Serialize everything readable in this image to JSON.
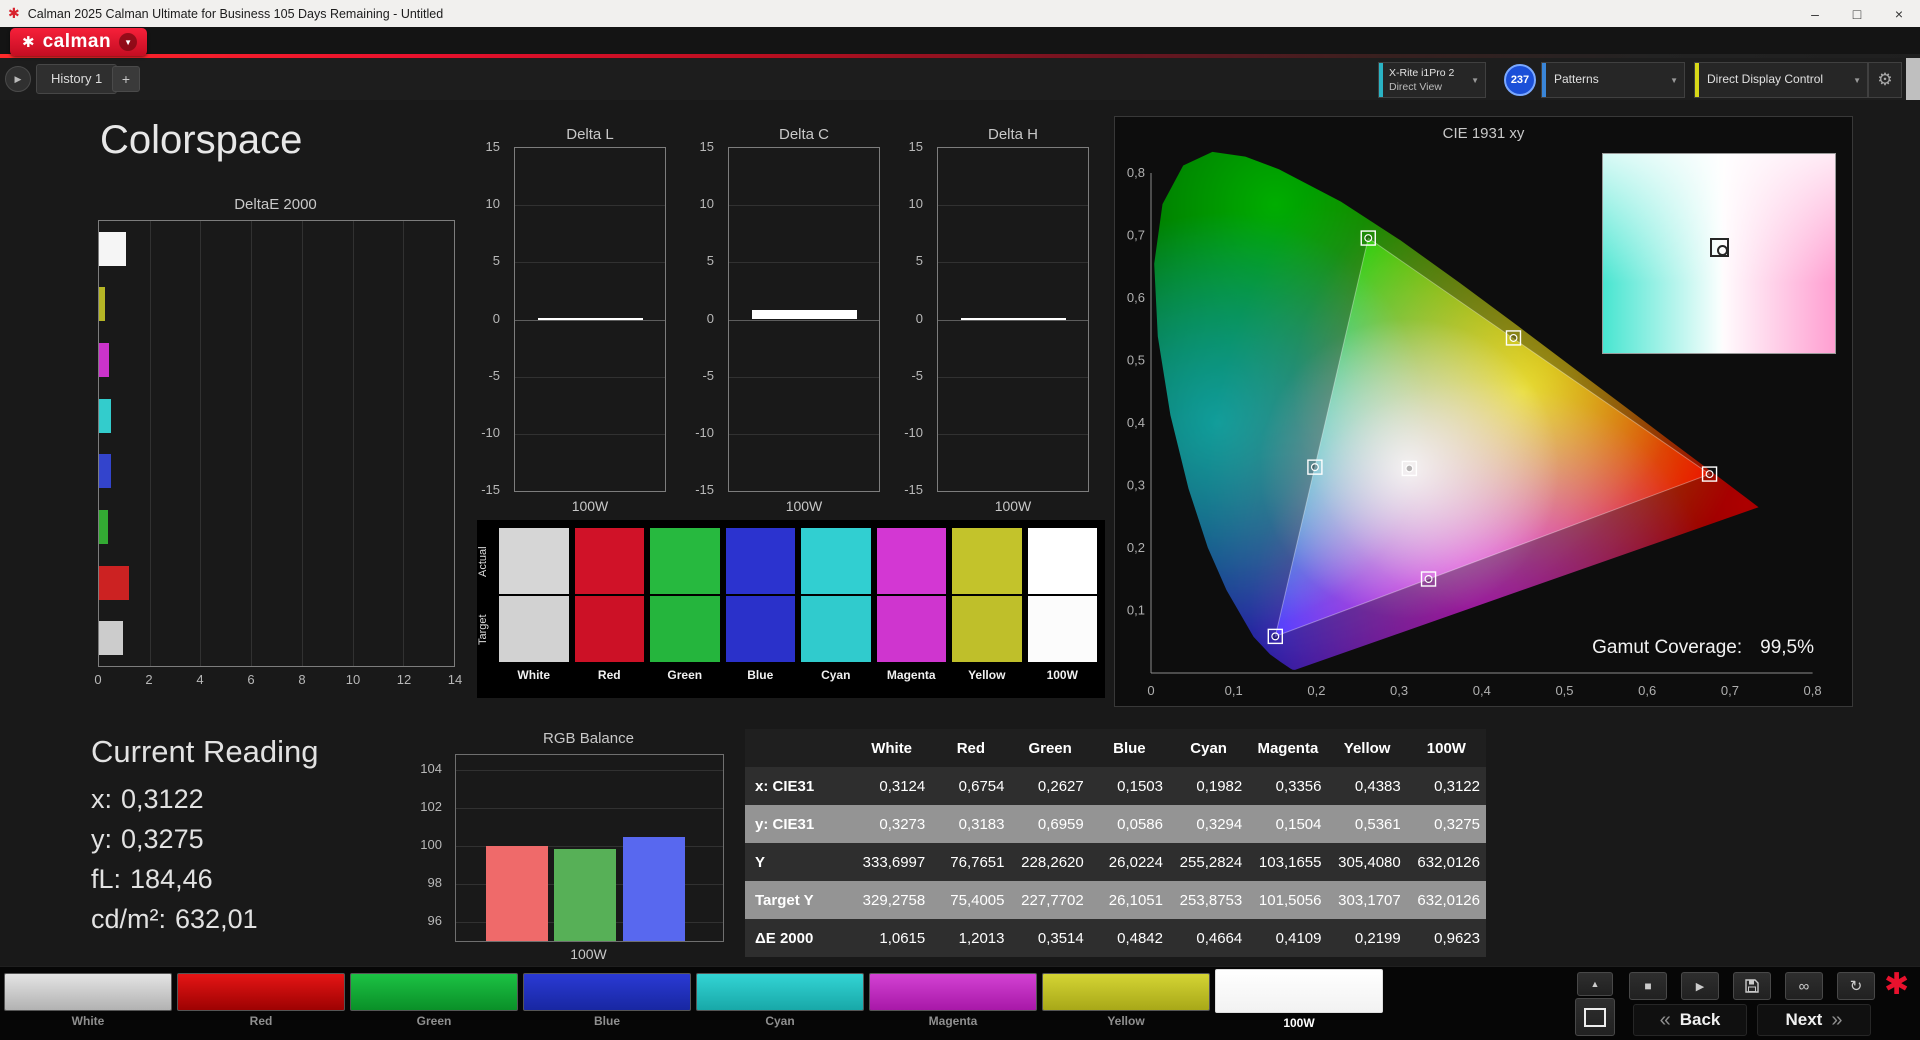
{
  "window": {
    "title": "Calman 2025 Calman Ultimate for Business 105 Days Remaining - Untitled",
    "minimize_glyph": "–",
    "maximize_glyph": "□",
    "close_glyph": "×"
  },
  "brand": {
    "logo_text": "calman"
  },
  "glyphs": {
    "flower": "✱",
    "caret_down": "▼",
    "tab_arrow": "▶",
    "plus": "+",
    "gear": "⚙"
  },
  "tab_bar": {
    "history_tab": "History 1",
    "meter": {
      "line1": "X-Rite i1Pro 2",
      "line2": "Direct View",
      "badge": "237"
    },
    "patterns_label": "Patterns",
    "display_control_label": "Direct Display Control"
  },
  "page": {
    "title": "Colorspace"
  },
  "delta_e_chart": {
    "title": "DeltaE 2000",
    "x_max": 14,
    "x_ticks": [
      "0",
      "2",
      "4",
      "6",
      "8",
      "10",
      "12",
      "14"
    ],
    "bars": [
      {
        "name": "White",
        "color": "#f5f5f5",
        "value": 1.0615
      },
      {
        "name": "Yellow",
        "color": "#b5b525",
        "value": 0.2199
      },
      {
        "name": "Magenta",
        "color": "#cc33cc",
        "value": 0.4109
      },
      {
        "name": "Cyan",
        "color": "#33cccc",
        "value": 0.4664
      },
      {
        "name": "Blue",
        "color": "#3344cc",
        "value": 0.4842
      },
      {
        "name": "Green",
        "color": "#33aa33",
        "value": 0.3514
      },
      {
        "name": "Red",
        "color": "#cc2222",
        "value": 1.2013
      },
      {
        "name": "100W",
        "color": "#cccccc",
        "value": 0.9623
      }
    ]
  },
  "delta_axis": {
    "min": -15,
    "max": 15,
    "ticks": [
      15,
      10,
      5,
      0,
      -5,
      -10,
      -15
    ]
  },
  "delta_charts": [
    {
      "title": "Delta L",
      "value": 0.15,
      "category": "100W"
    },
    {
      "title": "Delta C",
      "value": 0.8,
      "category": "100W"
    },
    {
      "title": "Delta H",
      "value": 0.1,
      "category": "100W"
    }
  ],
  "swatch_panel": {
    "row_labels": [
      "Actual",
      "Target"
    ],
    "columns": [
      {
        "label": "White",
        "actual": "#d6d6d6",
        "target": "#d2d2d2"
      },
      {
        "label": "Red",
        "actual": "#d01228",
        "target": "#cc1126"
      },
      {
        "label": "Green",
        "actual": "#27b93f",
        "target": "#25b53d"
      },
      {
        "label": "Blue",
        "actual": "#2b33cf",
        "target": "#2a31ca"
      },
      {
        "label": "Cyan",
        "actual": "#31cfd1",
        "target": "#30cbcd"
      },
      {
        "label": "Magenta",
        "actual": "#d337d3",
        "target": "#cf35cf"
      },
      {
        "label": "Yellow",
        "actual": "#c3c32b",
        "target": "#bfbf2a"
      },
      {
        "label": "100W",
        "actual": "#ffffff",
        "target": "#fcfcfc"
      }
    ]
  },
  "cie": {
    "title": "CIE 1931 xy",
    "gamut_coverage_label": "Gamut Coverage:",
    "gamut_coverage_value": "99,5%",
    "x_ticks": [
      "0",
      "0,1",
      "0,2",
      "0,3",
      "0,4",
      "0,5",
      "0,6",
      "0,7",
      "0,8"
    ],
    "y_ticks": [
      "0",
      "0,1",
      "0,2",
      "0,3",
      "0,4",
      "0,5",
      "0,6",
      "0,7",
      "0,8"
    ],
    "points": [
      {
        "name": "white",
        "x": 0.3124,
        "y": 0.3273
      },
      {
        "name": "red",
        "x": 0.6754,
        "y": 0.3183
      },
      {
        "name": "green",
        "x": 0.2627,
        "y": 0.6959
      },
      {
        "name": "blue",
        "x": 0.1503,
        "y": 0.0586
      },
      {
        "name": "cyan",
        "x": 0.1982,
        "y": 0.3294
      },
      {
        "name": "magenta",
        "x": 0.3356,
        "y": 0.1504
      },
      {
        "name": "yellow",
        "x": 0.4383,
        "y": 0.5361
      }
    ]
  },
  "current_reading": {
    "title": "Current Reading",
    "lines": [
      {
        "label": "x:",
        "value": "0,3122"
      },
      {
        "label": "y:",
        "value": "0,3275"
      },
      {
        "label": "fL:",
        "value": "184,46"
      },
      {
        "label": "cd/m²:",
        "value": "632,01"
      }
    ]
  },
  "rgb_balance": {
    "title": "RGB Balance",
    "category": "100W",
    "y_ticks": [
      104,
      102,
      100,
      98,
      96
    ],
    "bars": [
      {
        "name": "red",
        "color": "#ef6a6a",
        "value": 100.0
      },
      {
        "name": "green",
        "color": "#57b057",
        "value": 99.85
      },
      {
        "name": "blue",
        "color": "#5868ef",
        "value": 100.45
      }
    ]
  },
  "table": {
    "columns": [
      "White",
      "Red",
      "Green",
      "Blue",
      "Cyan",
      "Magenta",
      "Yellow",
      "100W"
    ],
    "rows": [
      {
        "label": "x: CIE31",
        "values": [
          "0,3124",
          "0,6754",
          "0,2627",
          "0,1503",
          "0,1982",
          "0,3356",
          "0,4383",
          "0,3122"
        ]
      },
      {
        "label": "y: CIE31",
        "values": [
          "0,3273",
          "0,3183",
          "0,6959",
          "0,0586",
          "0,3294",
          "0,1504",
          "0,5361",
          "0,3275"
        ]
      },
      {
        "label": "Y",
        "values": [
          "333,6997",
          "76,7651",
          "228,2620",
          "26,0224",
          "255,2824",
          "103,1655",
          "305,4080",
          "632,0126"
        ]
      },
      {
        "label": "Target Y",
        "values": [
          "329,2758",
          "75,4005",
          "227,7702",
          "26,1051",
          "253,8753",
          "101,5056",
          "303,1707",
          "632,0126"
        ]
      },
      {
        "label": "ΔE 2000",
        "values": [
          "1,0615",
          "1,2013",
          "0,3514",
          "0,4842",
          "0,4664",
          "0,4109",
          "0,2199",
          "0,9623"
        ]
      }
    ]
  },
  "pattern_buttons": [
    {
      "label": "White",
      "color1": "#e4e4e4",
      "color2": "#b2b2b2",
      "selected": false
    },
    {
      "label": "Red",
      "color1": "#e51515",
      "color2": "#9d0202",
      "selected": false
    },
    {
      "label": "Green",
      "color1": "#1cc244",
      "color2": "#0a9028",
      "selected": false
    },
    {
      "label": "Blue",
      "color1": "#2a3ad4",
      "color2": "#1827a2",
      "selected": false
    },
    {
      "label": "Cyan",
      "color1": "#33d4d4",
      "color2": "#18a8a8",
      "selected": false
    },
    {
      "label": "Magenta",
      "color1": "#d342d3",
      "color2": "#a818a8",
      "selected": false
    },
    {
      "label": "Yellow",
      "color1": "#d4d434",
      "color2": "#a8a818",
      "selected": false
    },
    {
      "label": "100W",
      "color1": "#ffffff",
      "color2": "#f2f2f2",
      "selected": true
    }
  ],
  "transport": {
    "collapse_icon": "▲",
    "stop_icon": "■",
    "play_icon": "▶",
    "loop_icon": "∞",
    "refresh_icon": "↻",
    "back_chevron": "«",
    "next_chevron": "»",
    "back_label": "Back",
    "next_label": "Next",
    "session_icon": "✱"
  }
}
